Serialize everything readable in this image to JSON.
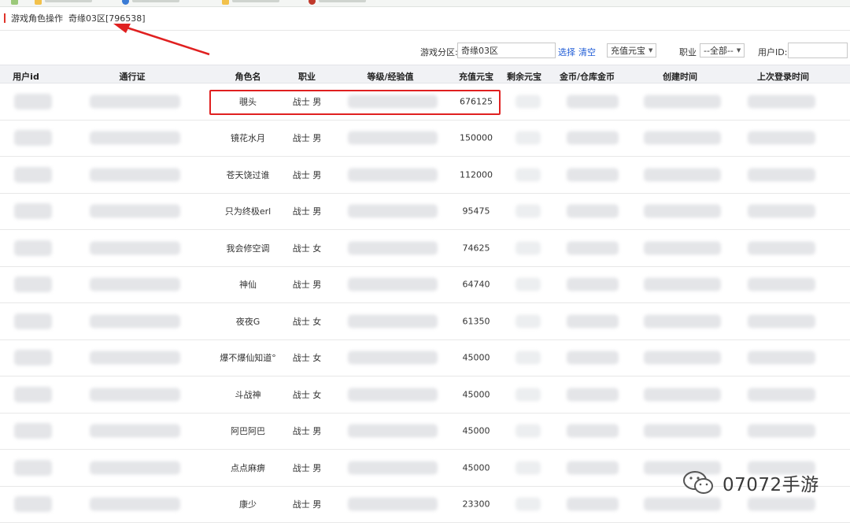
{
  "breadcrumb": {
    "title": "游戏角色操作",
    "zone": "奇缘03区[796538]"
  },
  "filters": {
    "zone_label": "游戏分区:",
    "zone_value": "奇缘03区",
    "select_link": "选择",
    "clear_link": "清空",
    "sort_value": "充值元宝",
    "job_label": "职业",
    "job_value": "--全部--",
    "userid_label": "用户ID:",
    "userid_value": ""
  },
  "table": {
    "headers": [
      "用户id",
      "通行证",
      "角色名",
      "职业",
      "等级/经验值",
      "充值元宝",
      "剩余元宝",
      "金币/仓库金币",
      "创建时间",
      "上次登录时间"
    ],
    "rows": [
      {
        "name": "覗头",
        "job": "战士 男",
        "recharge": "676125"
      },
      {
        "name": "镜花水月",
        "job": "战士 男",
        "recharge": "150000"
      },
      {
        "name": "苍天饶过谁",
        "job": "战士 男",
        "recharge": "112000"
      },
      {
        "name": "只为终极erl",
        "job": "战士 男",
        "recharge": "95475"
      },
      {
        "name": "我会修空调",
        "job": "战士 女",
        "recharge": "74625"
      },
      {
        "name": "神仙",
        "job": "战士 男",
        "recharge": "64740"
      },
      {
        "name": "夜夜G",
        "job": "战士 女",
        "recharge": "61350"
      },
      {
        "name": "爆不爆仙知道°",
        "job": "战士 女",
        "recharge": "45000"
      },
      {
        "name": "斗战神",
        "job": "战士 女",
        "recharge": "45000"
      },
      {
        "name": "阿巴阿巴",
        "job": "战士 男",
        "recharge": "45000"
      },
      {
        "name": "点点麻痹",
        "job": "战士 男",
        "recharge": "45000"
      },
      {
        "name": "康少",
        "job": "战士 男",
        "recharge": "23300"
      }
    ]
  },
  "watermark": {
    "text": "07072手游",
    "icon": "wechat-icon"
  },
  "colors": {
    "accent_red": "#e02020",
    "link_blue": "#1e5bd6",
    "header_bg": "#f1f2f5"
  }
}
